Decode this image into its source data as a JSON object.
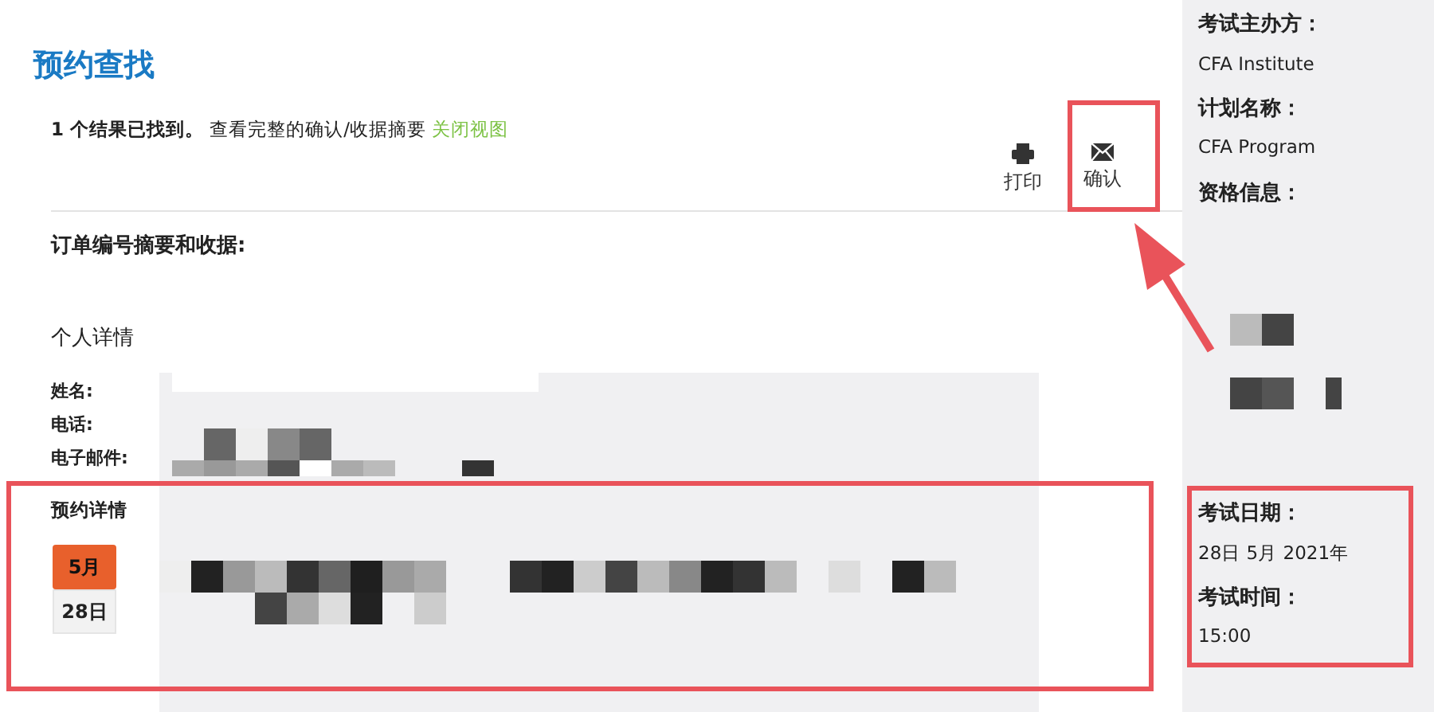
{
  "title": "预约查找",
  "summary": {
    "count": "1 个结果已找到。",
    "text": "查看完整的确认/收据摘要",
    "link": "关闭视图"
  },
  "actions": [
    {
      "kind": "print",
      "label": "打印"
    },
    {
      "kind": "mail",
      "label": "确认"
    }
  ],
  "receipt_heading": "订单编号摘要和收据:",
  "personal": {
    "heading": "个人详情",
    "fields": [
      "姓名:",
      "电话:",
      "电子邮件:"
    ]
  },
  "appointment": {
    "heading": "预约详情",
    "month": "5月",
    "day": "28日"
  },
  "sidebar": [
    {
      "kind": "text",
      "label": "考试主办方：",
      "value": "CFA Institute"
    },
    {
      "kind": "text",
      "label": "计划名称：",
      "value": "CFA Program"
    },
    {
      "kind": "redacted",
      "label": "资格信息："
    },
    {
      "kind": "text",
      "label": "考试日期：",
      "value": "28日 5月 2021年"
    },
    {
      "kind": "text",
      "label": "考试时间：",
      "value": "15:00"
    }
  ]
}
